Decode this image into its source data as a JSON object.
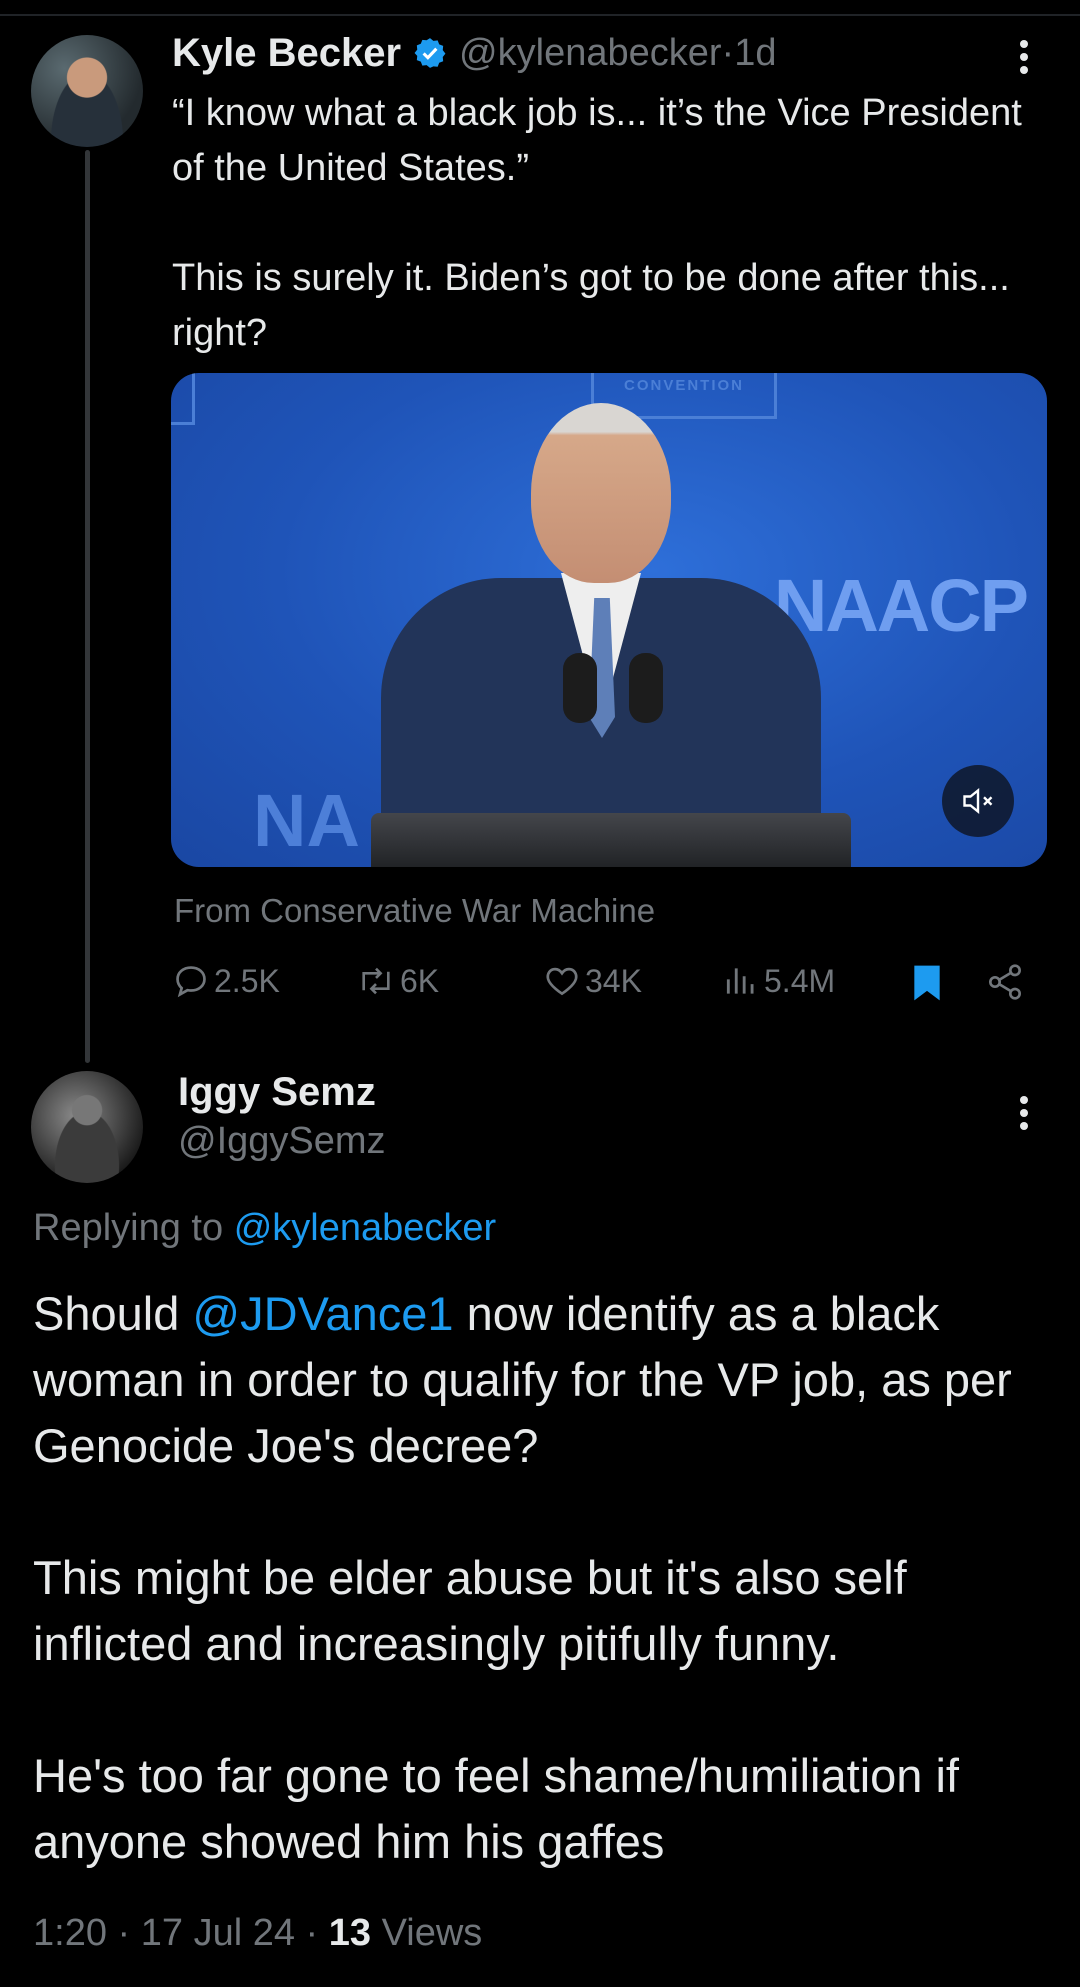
{
  "tweet": {
    "author_name": "Kyle Becker",
    "author_handle": "@kylenabecker",
    "time_sep": " · ",
    "age": "1d",
    "text_p1": "“I know what a black job is... it’s the Vice President of the United States.”",
    "text_p2": "This is surely it. Biden’s got to be done after this... right?",
    "video": {
      "banner_top": "CONVENTION",
      "banner_right": "NAACP",
      "banner_left": "NA"
    },
    "source_prefix": "From",
    "source_name": "Conservative War Machine",
    "stats": {
      "replies": "2.5K",
      "reposts": "6K",
      "likes": "34K",
      "views": "5.4M"
    }
  },
  "reply": {
    "author_name": "Iggy Semz",
    "author_handle": "@IggySemz",
    "replying_prefix": "Replying to",
    "replying_handle": "@kylenabecker",
    "p1_before": "Should",
    "p1_mention": "@JDVance1",
    "p1_after": "now identify as a black woman in order to qualify for the VP job, as per Genocide Joe's decree?",
    "p2": "This might be elder abuse but it's also self inflicted and increasingly pitifully funny.",
    "p3": "He's too far gone to feel shame/humiliation if anyone showed him his gaffes",
    "time": "1:20",
    "sep": " · ",
    "date": "17 Jul 24",
    "views_count": "13",
    "views_label": "Views"
  },
  "colors": {
    "background": "#000000",
    "text": "#e7e9ea",
    "muted": "#71767b",
    "accent": "#1d9bf0"
  },
  "icons": [
    "verified-badge-icon",
    "more-icon",
    "mute-icon",
    "reply-icon",
    "repost-icon",
    "like-icon",
    "views-icon",
    "bookmark-icon",
    "share-icon"
  ]
}
